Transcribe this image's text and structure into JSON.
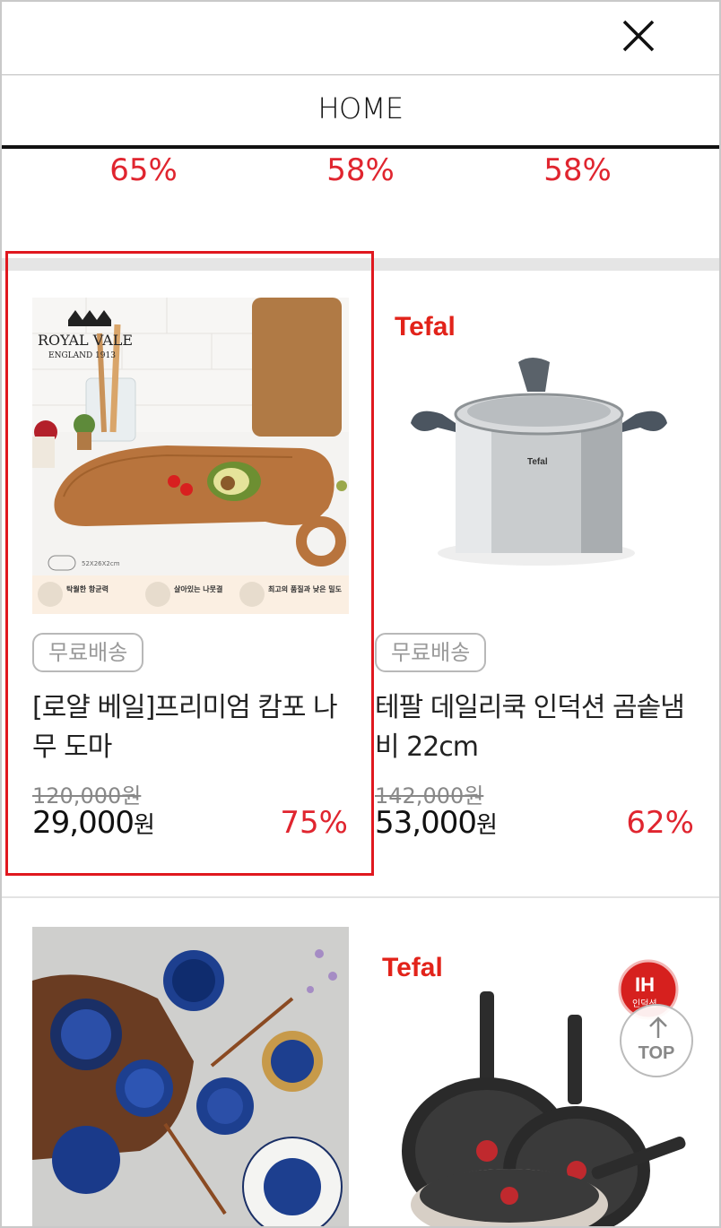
{
  "header": {
    "close_icon": "close-icon"
  },
  "tabs": {
    "home_label": "HOME"
  },
  "discount_row": [
    "65%",
    "58%",
    "58%"
  ],
  "products": [
    {
      "badge": "무료배송",
      "name": "[로얄 베일]프리미엄 캄포 나무 도마",
      "original_price": "120,000원",
      "sale_price": "29,000",
      "sale_unit": "원",
      "discount": "75%",
      "image_brand": "ROYAL VALE",
      "image_brand_sub": "ENGLAND 1913",
      "image_size": "52X26X2cm",
      "image_features": [
        "탁월한 항균력",
        "살아있는 나뭇결",
        "최고의 품질과 낮은 밀도"
      ]
    },
    {
      "badge": "무료배송",
      "name": "테팔 데일리쿡 인덕션 곰솥냄비 22cm",
      "original_price": "142,000원",
      "sale_price": "53,000",
      "sale_unit": "원",
      "discount": "62%",
      "image_brand": "Tefal",
      "image_pot_logo": "Tefal"
    },
    {
      "image_alt": "blue-ceramic-dishes"
    },
    {
      "image_brand": "Tefal",
      "image_badge_main": "IH",
      "image_badge_sub": "인덕션"
    }
  ],
  "top_button": {
    "label": "TOP"
  },
  "colors": {
    "accent": "#e0252f",
    "highlight": "#e0181f",
    "tefal_red": "#e2231a"
  }
}
